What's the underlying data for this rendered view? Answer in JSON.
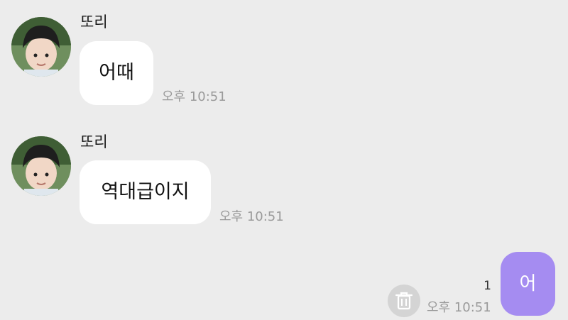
{
  "messages": [
    {
      "sender": "또리",
      "text": "어때",
      "time": "오후 10:51"
    },
    {
      "sender": "또리",
      "text": "역대급이지",
      "time": "오후 10:51"
    }
  ],
  "my_message": {
    "text": "어",
    "time": "오후 10:51",
    "unread_count": "1"
  },
  "colors": {
    "background": "#ececec",
    "incoming_bubble": "#ffffff",
    "outgoing_bubble": "#a58cf1",
    "timestamp": "#9a9a9a"
  },
  "icons": {
    "delete": "trash-icon"
  }
}
